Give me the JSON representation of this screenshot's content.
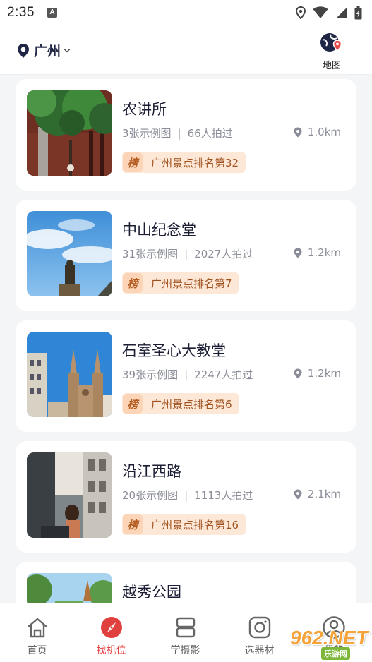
{
  "status_bar": {
    "time": "2:35",
    "a_icon": "A"
  },
  "header": {
    "city": "广州",
    "map_label": "地图"
  },
  "spots": [
    {
      "name": "农讲所",
      "photos": "3张示例图",
      "people": "66人拍过",
      "distance": "1.0km",
      "rank_icon": "榜",
      "rank": "广州景点排名第32"
    },
    {
      "name": "中山纪念堂",
      "photos": "31张示例图",
      "people": "2027人拍过",
      "distance": "1.2km",
      "rank_icon": "榜",
      "rank": "广州景点排名第7"
    },
    {
      "name": "石室圣心大教堂",
      "photos": "39张示例图",
      "people": "2247人拍过",
      "distance": "1.2km",
      "rank_icon": "榜",
      "rank": "广州景点排名第6"
    },
    {
      "name": "沿江西路",
      "photos": "20张示例图",
      "people": "1113人拍过",
      "distance": "2.1km",
      "rank_icon": "榜",
      "rank": "广州景点排名第16"
    },
    {
      "name": "越秀公园"
    }
  ],
  "separator": "|",
  "nav": [
    {
      "label": "首页",
      "icon": "home-icon"
    },
    {
      "label": "找机位",
      "icon": "compass-icon",
      "active": true
    },
    {
      "label": "学摄影",
      "icon": "book-icon"
    },
    {
      "label": "选器材",
      "icon": "camera-icon"
    },
    {
      "label": "我的",
      "icon": "user-icon"
    }
  ],
  "watermark": {
    "text": "962.NET",
    "sub": "乐游网"
  },
  "colors": {
    "accent": "#e0413f",
    "navy": "#1f2544",
    "rank_bg": "#fde8d8",
    "rank_text": "#a0521e"
  }
}
